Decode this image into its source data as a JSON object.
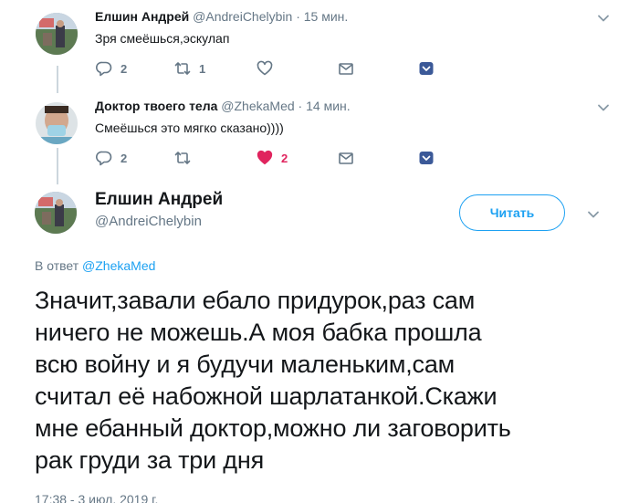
{
  "reply1": {
    "display_name": "Елшин Андрей",
    "handle": "@AndreiChelybin",
    "separator": "·",
    "time": "15 мин.",
    "text": "Зря смеёшься,эскулап",
    "replies": "2",
    "retweets": "1",
    "likes": ""
  },
  "reply2": {
    "display_name": "Доктор твоего тела",
    "handle": "@ZhekaMed",
    "separator": "·",
    "time": "14 мин.",
    "text": "Смеёшься это мягко сказано))))",
    "replies": "2",
    "retweets": "",
    "likes": "2"
  },
  "main_tweet": {
    "display_name": "Елшин Андрей",
    "handle": "@AndreiChelybin",
    "follow_label": "Читать",
    "reply_prefix": "В ответ",
    "reply_mention": "@ZhekaMed",
    "text_lines": [
      "Значит,завали ебало придурок,раз сам",
      "ничего не можешь.А моя бабка прошла",
      "всю войну и я будучи маленьким,сам",
      "считал её набожной шарлатанкой.Скажи",
      "мне ебанный доктор,можно ли заговорить",
      "рак груди за три дня"
    ],
    "timestamp": "17:38 - 3 июл. 2019 г."
  },
  "colors": {
    "accent": "#1da1f2",
    "like": "#e0245e",
    "muted": "#657786",
    "verified_dm": "#3b5998"
  },
  "icons": {
    "reply": "reply-icon",
    "retweet": "retweet-icon",
    "like": "heart-icon",
    "dm": "envelope-icon",
    "more": "chevron-down-icon"
  }
}
